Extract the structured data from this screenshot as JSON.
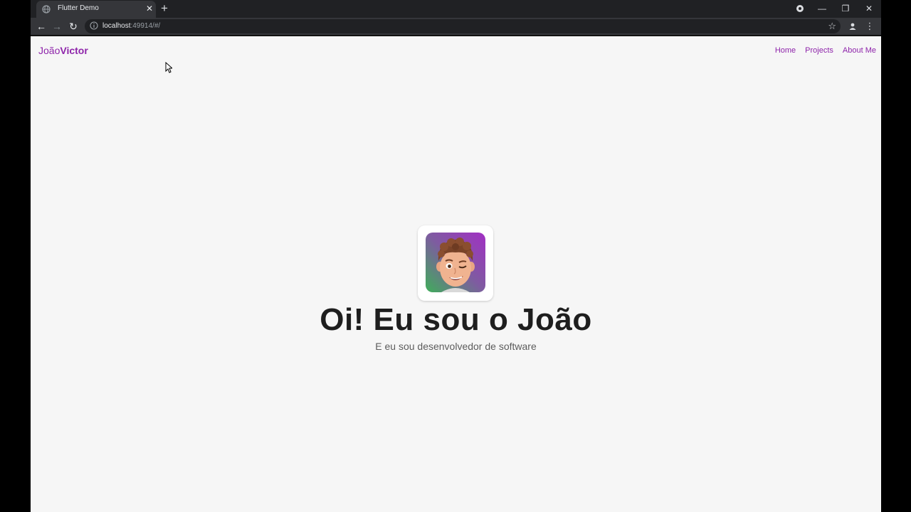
{
  "browser": {
    "tab_title": "Flutter Demo",
    "url_host": "localhost",
    "url_rest": ":49914/#/"
  },
  "page": {
    "brand_light": "João",
    "brand_bold": "Victor",
    "nav": [
      "Home",
      "Projects",
      "About Me"
    ],
    "hero_title": "Oi! Eu sou o João",
    "hero_subtitle": "E eu sou desenvolvedor de software"
  },
  "colors": {
    "accent": "#8e24aa",
    "page_bg": "#f6f6f6",
    "chrome_dark": "#202124",
    "chrome_mid": "#35363a"
  }
}
